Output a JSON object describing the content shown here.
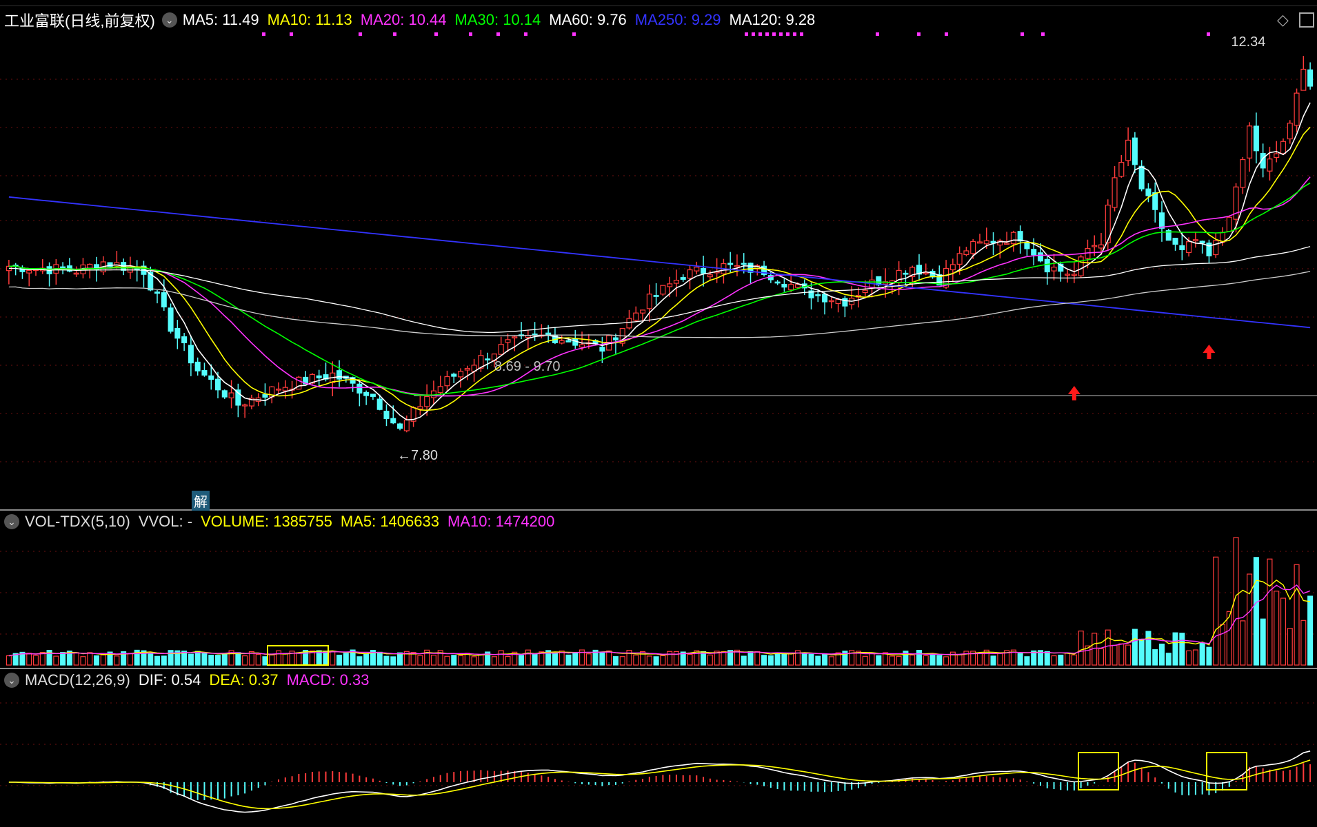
{
  "header": {
    "stock_name": "工业富联(日线,前复权)",
    "ma": [
      {
        "label": "MA5: 11.49",
        "color": "#ffffff"
      },
      {
        "label": "MA10: 11.13",
        "color": "#ffff00"
      },
      {
        "label": "MA20: 10.44",
        "color": "#ff33ff"
      },
      {
        "label": "MA30: 10.14",
        "color": "#00ff00"
      },
      {
        "label": "MA60: 9.76",
        "color": "#ffffff"
      },
      {
        "label": "MA250: 9.29",
        "color": "#3333ff"
      },
      {
        "label": "MA120: 9.28",
        "color": "#ffffff"
      }
    ]
  },
  "price_panel": {
    "annot_high": "12.34",
    "annot_low": "7.80",
    "annot_range": "8.69 - 9.70",
    "event_badge": "解"
  },
  "volume_panel": {
    "title": "VOL-TDX(5,10)",
    "vvol": "VVOL: -",
    "volume": "VOLUME: 1385755",
    "ma5": "MA5: 1406633",
    "ma10": "MA10: 1474200"
  },
  "macd_panel": {
    "title": "MACD(12,26,9)",
    "dif": "DIF: 0.54",
    "dea": "DEA: 0.37",
    "macd": "MACD: 0.33"
  },
  "colors": {
    "up": "#ff3b3b",
    "down": "#54fcfc",
    "ma5": "#ffffff",
    "ma10": "#ffff00",
    "ma20": "#ff33ff",
    "ma30": "#00ff00",
    "ma60": "#ffffff",
    "ma120": "#ffffff",
    "ma250": "#3333ff",
    "dif": "#ffffff",
    "dea": "#ffff00",
    "highlight": "#ffff00"
  },
  "chart_data": {
    "type": "candlestick",
    "y_range": [
      7.3,
      12.6
    ],
    "ma250": {
      "start": 10.8,
      "end": 9.29
    },
    "ma120": {
      "start": 9.4,
      "end": 9.28
    },
    "ma60": {
      "start": 9.95,
      "end": 9.76
    },
    "keys": [
      [
        0,
        10.0
      ],
      [
        10,
        9.95
      ],
      [
        14,
        10.05
      ],
      [
        20,
        9.95
      ],
      [
        24,
        9.3
      ],
      [
        28,
        8.8
      ],
      [
        34,
        8.4
      ],
      [
        40,
        8.6
      ],
      [
        48,
        8.75
      ],
      [
        54,
        8.5
      ],
      [
        58,
        8.1
      ],
      [
        62,
        8.5
      ],
      [
        68,
        8.85
      ],
      [
        74,
        9.1
      ],
      [
        80,
        9.2
      ],
      [
        88,
        9.05
      ],
      [
        94,
        9.55
      ],
      [
        100,
        9.9
      ],
      [
        106,
        10.0
      ],
      [
        112,
        9.95
      ],
      [
        118,
        9.7
      ],
      [
        124,
        9.6
      ],
      [
        128,
        9.8
      ],
      [
        134,
        10.0
      ],
      [
        138,
        9.85
      ],
      [
        142,
        10.2
      ],
      [
        146,
        10.3
      ],
      [
        150,
        10.35
      ],
      [
        154,
        10.0
      ],
      [
        158,
        9.9
      ],
      [
        160,
        10.2
      ],
      [
        162,
        10.3
      ],
      [
        164,
        11.0
      ],
      [
        166,
        11.4
      ],
      [
        168,
        10.9
      ],
      [
        170,
        10.6
      ],
      [
        172,
        10.3
      ],
      [
        174,
        10.15
      ],
      [
        176,
        10.3
      ],
      [
        178,
        10.1
      ],
      [
        180,
        10.4
      ],
      [
        182,
        10.85
      ],
      [
        184,
        11.6
      ],
      [
        186,
        11.1
      ],
      [
        188,
        11.3
      ],
      [
        190,
        11.6
      ],
      [
        192,
        12.34
      ],
      [
        193,
        12.1
      ]
    ],
    "n_candles": 194
  }
}
